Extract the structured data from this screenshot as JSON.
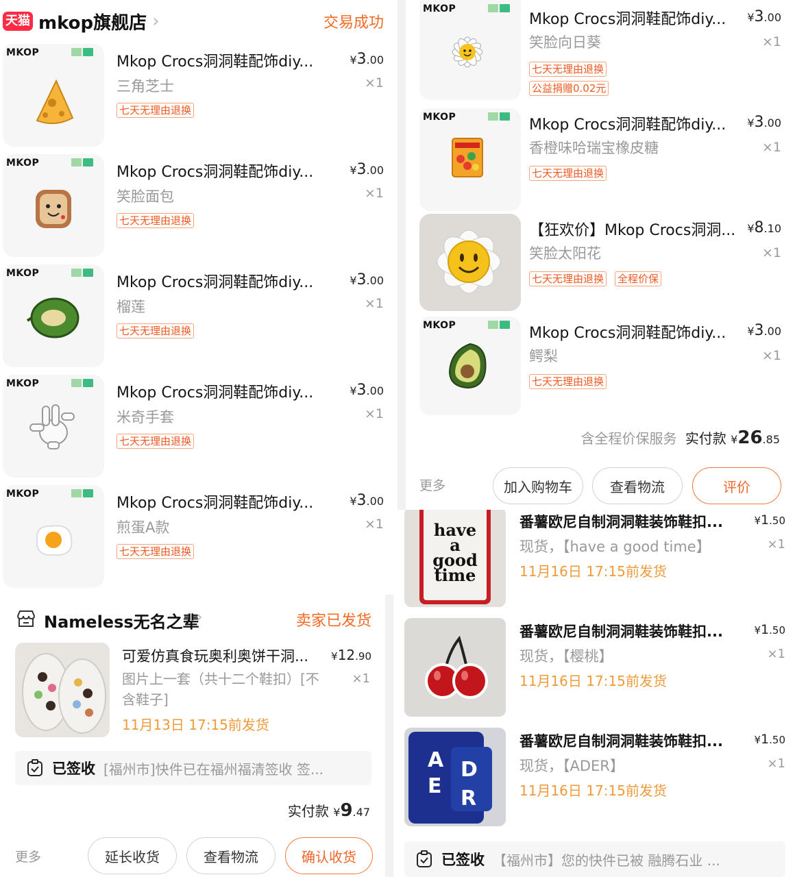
{
  "mkop_left": {
    "store_badge": "天猫",
    "store_name": "mkop旗舰店",
    "status": "交易成功",
    "brand_tag": "MKOP",
    "items": [
      {
        "title": "Mkop Crocs洞洞鞋配饰diy...",
        "price_int": "3",
        "price_dec": ".00",
        "variant": "三角芝士",
        "qty": "×1",
        "tag": "七天无理由退换"
      },
      {
        "title": "Mkop Crocs洞洞鞋配饰diy...",
        "price_int": "3",
        "price_dec": ".00",
        "variant": "笑脸面包",
        "qty": "×1",
        "tag": "七天无理由退换"
      },
      {
        "title": "Mkop Crocs洞洞鞋配饰diy...",
        "price_int": "3",
        "price_dec": ".00",
        "variant": "榴莲",
        "qty": "×1",
        "tag": "七天无理由退换"
      },
      {
        "title": "Mkop Crocs洞洞鞋配饰diy...",
        "price_int": "3",
        "price_dec": ".00",
        "variant": "米奇手套",
        "qty": "×1",
        "tag": "七天无理由退换"
      },
      {
        "title": "Mkop Crocs洞洞鞋配饰diy...",
        "price_int": "3",
        "price_dec": ".00",
        "variant": "煎蛋A款",
        "qty": "×1",
        "tag": "七天无理由退换"
      }
    ]
  },
  "mkop_right": {
    "brand_tag": "MKOP",
    "items": [
      {
        "title": "Mkop Crocs洞洞鞋配饰diy...",
        "price_int": "3",
        "price_dec": ".00",
        "variant": "笑脸向日葵",
        "qty": "×1",
        "tag": "七天无理由退换",
        "tag2": "公益捐赠0.02元"
      },
      {
        "title": "Mkop Crocs洞洞鞋配饰diy...",
        "price_int": "3",
        "price_dec": ".00",
        "variant": "香橙味哈瑞宝橡皮糖",
        "qty": "×1",
        "tag": "七天无理由退换"
      },
      {
        "title": "【狂欢价】Mkop Crocs洞洞...",
        "price_int": "8",
        "price_dec": ".10",
        "variant": "笑脸太阳花",
        "qty": "×1",
        "tag": "七天无理由退换",
        "tag_b": "全程价保"
      },
      {
        "title": "Mkop Crocs洞洞鞋配饰diy...",
        "price_int": "3",
        "price_dec": ".00",
        "variant": "鳄梨",
        "qty": "×1",
        "tag": "七天无理由退换"
      }
    ],
    "summary_prefix": "含全程价保服务",
    "summary_label": "实付款",
    "total_int": "26",
    "total_dec": ".85",
    "more": "更多",
    "buttons": [
      "加入购物车",
      "查看物流",
      "评价"
    ]
  },
  "nameless": {
    "store_name": "Nameless无名之辈",
    "status": "卖家已发货",
    "item": {
      "title": "可爱仿真食玩奥利奥饼干洞...",
      "price_int": "12",
      "price_dec": ".90",
      "variant": "图片上一套（共十二个鞋扣）[不含鞋子]",
      "qty": "×1",
      "ship": "11月13日 17:15前发货"
    },
    "sign_label": "已签收",
    "sign_text": "[福州市]快件已在福州福清签收 签...",
    "total_label": "实付款",
    "total_int": "9",
    "total_dec": ".47",
    "more": "更多",
    "buttons": [
      "延长收货",
      "查看物流",
      "确认收货"
    ]
  },
  "shuyu": {
    "items": [
      {
        "title": "番薯欧尼自制洞洞鞋装饰鞋扣...",
        "price_int": "1",
        "price_dec": ".50",
        "variant": "现货，【have a good time】",
        "qty": "×1",
        "ship": "11月16日 17:15前发货",
        "art_text": [
          "have",
          "a",
          "good",
          "time"
        ]
      },
      {
        "title": "番薯欧尼自制洞洞鞋装饰鞋扣...",
        "price_int": "1",
        "price_dec": ".50",
        "variant": "现货，【樱桃】",
        "qty": "×1",
        "ship": "11月16日 17:15前发货"
      },
      {
        "title": "番薯欧尼自制洞洞鞋装饰鞋扣...",
        "price_int": "1",
        "price_dec": ".50",
        "variant": "现货，【ADER】",
        "qty": "×1",
        "ship": "11月16日 17:15前发货",
        "art_text": [
          "A",
          "D",
          "E",
          "R"
        ]
      }
    ],
    "sign_label": "已签收",
    "sign_text": "【福州市】您的快件已被 融腾石业 ..."
  },
  "currency": "¥",
  "colors": {
    "accent": "#f46a23",
    "tmall_red": "#ff2a43",
    "ship_orange": "#f09a3a",
    "tag_orange": "#f05a22"
  }
}
